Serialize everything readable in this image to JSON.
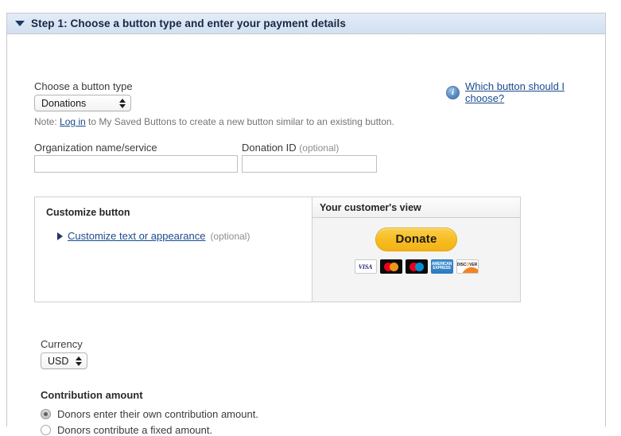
{
  "step": {
    "title": "Step 1: Choose a button type and enter your payment details",
    "collapse_icon": "triangle-down-icon"
  },
  "button_type": {
    "label": "Choose a button type",
    "selected": "Donations",
    "options": [
      "Donations"
    ],
    "note_prefix": "Note: ",
    "note_link": "Log in",
    "note_suffix": " to My Saved Buttons to create a new button similar to an existing button."
  },
  "help": {
    "icon": "info-icon",
    "link": "Which button should I choose?"
  },
  "organization": {
    "label": "Organization name/service",
    "value": "",
    "placeholder": ""
  },
  "donation_id": {
    "label": "Donation ID",
    "optional": "(optional)",
    "value": "",
    "placeholder": ""
  },
  "customize": {
    "title": "Customize button",
    "expand_icon": "triangle-right-icon",
    "link": "Customize text or appearance",
    "optional": "(optional)"
  },
  "customer_view": {
    "title": "Your customer's view",
    "donate_button_label": "Donate",
    "donate_button_color": "#f7bd23",
    "cards": [
      {
        "name": "visa-card-icon",
        "label": "VISA"
      },
      {
        "name": "mastercard-card-icon",
        "label": "mastercard"
      },
      {
        "name": "maestro-card-icon",
        "label": "maestro"
      },
      {
        "name": "amex-card-icon",
        "label": "AMERICAN EXPRESS"
      },
      {
        "name": "discover-card-icon",
        "label": "DISCOVER"
      }
    ]
  },
  "currency": {
    "label": "Currency",
    "selected": "USD",
    "options": [
      "USD"
    ]
  },
  "contribution": {
    "title": "Contribution amount",
    "options": [
      {
        "label": "Donors enter their own contribution amount.",
        "selected": true
      },
      {
        "label": "Donors contribute a fixed amount.",
        "selected": false
      }
    ]
  }
}
